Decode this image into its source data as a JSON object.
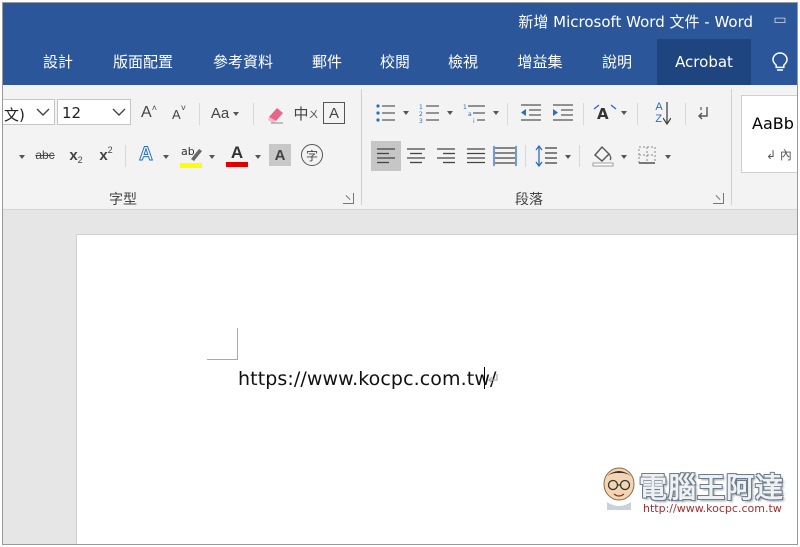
{
  "window": {
    "title": "新增 Microsoft Word 文件 - Word",
    "control_glyph": "▭"
  },
  "tabs": [
    {
      "label": "設計"
    },
    {
      "label": "版面配置"
    },
    {
      "label": "參考資料"
    },
    {
      "label": "郵件"
    },
    {
      "label": "校閱"
    },
    {
      "label": "檢視"
    },
    {
      "label": "增益集"
    },
    {
      "label": "說明"
    },
    {
      "label": "Acrobat",
      "active": true
    }
  ],
  "ribbon": {
    "font": {
      "font_name_fragment": "文)",
      "font_size": "12",
      "grow_font": "A",
      "shrink_font": "A",
      "change_case": "Aa",
      "phonetic": "中",
      "enclose_border": "A",
      "strikethrough": "abc",
      "subscript": "x",
      "subscript_mark": "2",
      "superscript": "x",
      "superscript_mark": "2",
      "text_effects": "A",
      "font_color": "A",
      "char_shading": "A",
      "enclose_char": "字",
      "label": "字型"
    },
    "paragraph": {
      "label": "段落",
      "sort_letters_top": "A",
      "sort_letters_bottom": "Z"
    },
    "styles": {
      "sample": "AaBb",
      "name": "↲ 內"
    },
    "colors": {
      "highlight": "#ffff00",
      "font_color": "#e00000",
      "shading_bg": "#c8c8c8"
    }
  },
  "document": {
    "text": "https://www.kocpc.com.tw/"
  },
  "watermark": {
    "brand": "電腦王阿達",
    "url": "http://www.kocpc.com.tw"
  },
  "theme": {
    "word_blue": "#2b579a",
    "active_tab": "#1e4580"
  }
}
